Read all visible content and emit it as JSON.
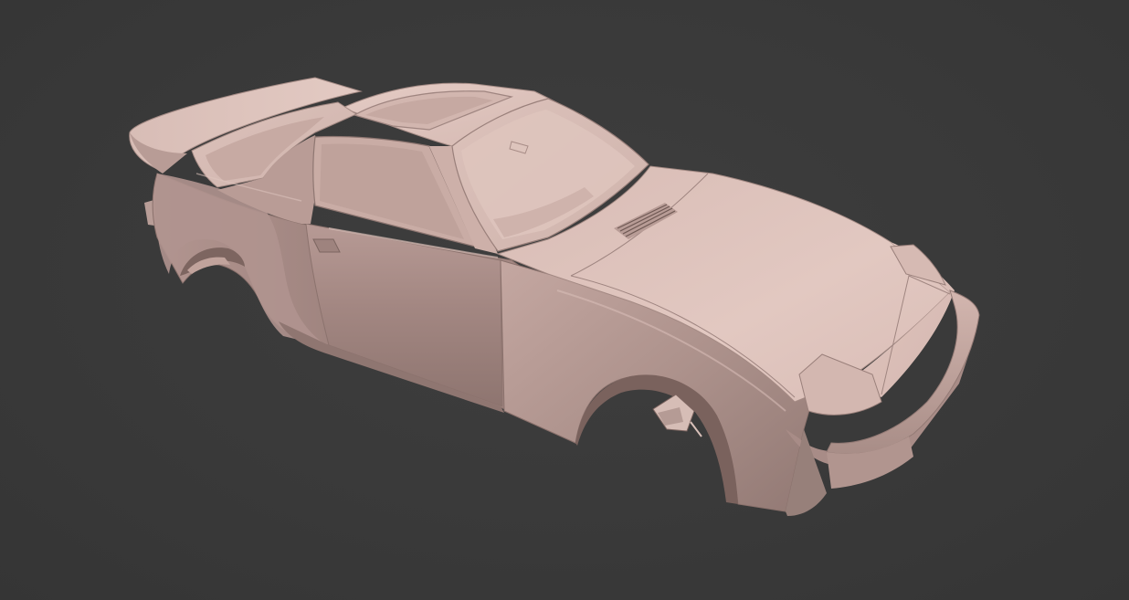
{
  "viewport": {
    "background_color": "#3a3a3a"
  },
  "model": {
    "material_color": "#c9aca6",
    "highlight_color": "#e9d3cc",
    "shadow_color": "#8f7772"
  }
}
